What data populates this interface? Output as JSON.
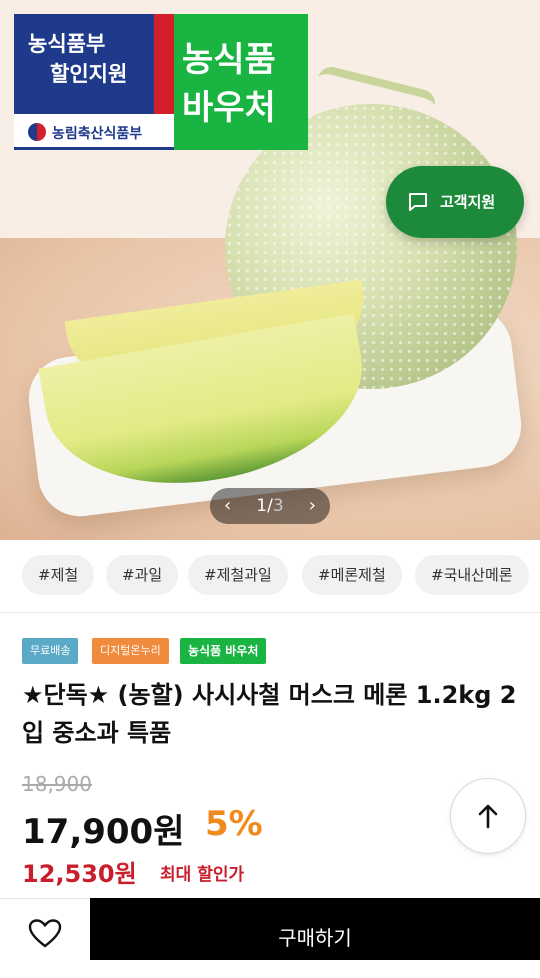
{
  "promo_badge": {
    "line1": "농식품부",
    "line2": "할인지원",
    "ministry": "농림축산식품부",
    "voucher_line1": "농식품",
    "voucher_line2": "바우처"
  },
  "support_button": {
    "label": "고객지원",
    "icon": "chat-bubble-icon"
  },
  "image_pager": {
    "current": "1",
    "separator": "/",
    "total": "3",
    "prev_icon": "chevron-left-icon",
    "next_icon": "chevron-right-icon"
  },
  "tags": [
    "#제철",
    "#과일",
    "#제철과일",
    "#메론제철",
    "#국내산메론"
  ],
  "chips": [
    {
      "label": "무료배송",
      "color": "#5aa9c6"
    },
    {
      "label": "디지털온누리",
      "color": "#f08a3c"
    },
    {
      "label": "농식품 바우처",
      "color": "#19b441"
    }
  ],
  "product": {
    "title": "★단독★ (농할) 사시사철 머스크 메론 1.2kg 2입 중소과 특품",
    "original_price": "18,900",
    "price": "17,900원",
    "discount": "5%",
    "max_discount_price": "12,530원",
    "max_discount_label": "최대 할인가"
  },
  "scroll_top_icon": "arrow-up-icon",
  "bottom_bar": {
    "wishlist_icon": "heart-icon",
    "buy_label": "구매하기"
  }
}
